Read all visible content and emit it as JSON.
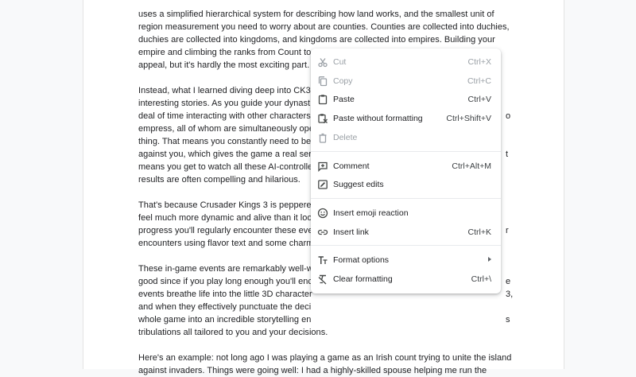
{
  "document": {
    "lines": [
      "uses a simplified hierarchical system for describing how land works, and the smallest unit of",
      "region measurement you need to worry about are counties. Counties are collected into duchies,",
      "duchies are collected into kingdoms, and kingdoms are collected into empires. Building your",
      "empire and climbing the ranks from Count to Duke to King to Emperor is a big part of CK3's",
      "appeal, but it's hardly the most exciting part.",
      "",
      "Instead, what I learned diving deep into CK3",
      "interesting stories. As you guide your dynast",
      "deal of time interacting with other characters",
      "empress, all of whom are simultaneously ope",
      "thing. That means you constantly need to be",
      "against you, which gives the game a real ser",
      "means you get to watch all these AI-controlle",
      "results are often compelling and hilarious.",
      "",
      "That's because Crusader Kings 3 is peppere",
      "feel much more dynamic and alive than it loo",
      "progress you'll regularly encounter these eve",
      "encounters using flavor text and some charm",
      "",
      "These in-game events are remarkably well-w",
      "good since if you play long enough you'll enc",
      "events breathe life into the little 3D character",
      "and when they effectively punctuate the deci",
      "whole game into an incredible storytelling en",
      "tribulations all tailored to you and your decisions.",
      "",
      "Here's an example: not long ago I was playing a game as an Irish count trying to unite the island",
      "against invaders. Things were going well: I had a highly-skilled spouse helping me run the"
    ],
    "right_fragments": [
      {
        "line": 8,
        "text": "o"
      },
      {
        "line": 11,
        "text": "t"
      },
      {
        "line": 17,
        "text": "r"
      },
      {
        "line": 21,
        "text": "e"
      },
      {
        "line": 22,
        "text": "3,"
      },
      {
        "line": 24,
        "text": "s"
      }
    ]
  },
  "context_menu": {
    "groups": [
      [
        {
          "label": "Cut",
          "shortcut": "Ctrl+X",
          "icon": "scissors-icon",
          "disabled": true
        },
        {
          "label": "Copy",
          "shortcut": "Ctrl+C",
          "icon": "copy-icon",
          "disabled": true
        },
        {
          "label": "Paste",
          "shortcut": "Ctrl+V",
          "icon": "clipboard-icon",
          "disabled": false
        },
        {
          "label": "Paste without formatting",
          "shortcut": "Ctrl+Shift+V",
          "icon": "paste-plain-icon",
          "disabled": false
        },
        {
          "label": "Delete",
          "shortcut": "",
          "icon": "trash-icon",
          "disabled": true
        }
      ],
      [
        {
          "label": "Comment",
          "shortcut": "Ctrl+Alt+M",
          "icon": "comment-add-icon",
          "disabled": false
        },
        {
          "label": "Suggest edits",
          "shortcut": "",
          "icon": "suggest-edit-icon",
          "disabled": false
        }
      ],
      [
        {
          "label": "Insert emoji reaction",
          "shortcut": "",
          "icon": "emoji-icon",
          "disabled": false
        },
        {
          "label": "Insert link",
          "shortcut": "Ctrl+K",
          "icon": "link-icon",
          "disabled": false
        }
      ],
      [
        {
          "label": "Format options",
          "shortcut": "",
          "icon": "text-format-icon",
          "disabled": false,
          "submenu": true
        },
        {
          "label": "Clear formatting",
          "shortcut": "Ctrl+\\",
          "icon": "clear-format-icon",
          "disabled": false
        }
      ]
    ]
  },
  "colors": {
    "text": "#202124",
    "disabled": "#9aa0a6",
    "icon": "#444746",
    "separator": "#e8eaed"
  }
}
